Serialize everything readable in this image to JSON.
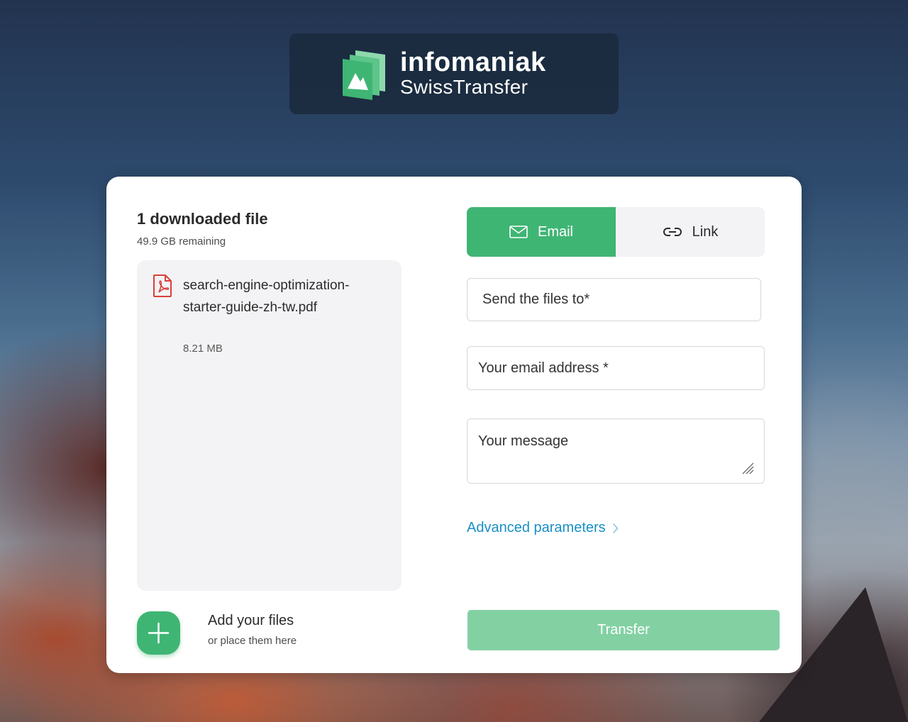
{
  "brand": {
    "name": "infomaniak",
    "product": "SwissTransfer"
  },
  "files": {
    "heading": "1 downloaded file",
    "remaining": "49.9 GB remaining",
    "items": [
      {
        "name": "search-engine-optimization-starter-guide-zh-tw.pdf",
        "size": "8.21 MB",
        "icon": "pdf-icon"
      }
    ],
    "add_title": "Add your files",
    "add_subtitle": "or place them here"
  },
  "tabs": {
    "email_label": "Email",
    "link_label": "Link",
    "active": "Email"
  },
  "form": {
    "to_placeholder": "Send the files to*",
    "from_placeholder": "Your email address *",
    "message_placeholder": "Your message",
    "advanced_label": "Advanced parameters",
    "transfer_label": "Transfer"
  },
  "colors": {
    "accent": "#3fb574",
    "accent_disabled": "#83d1a3",
    "link": "#1a8fc4",
    "pdf": "#d9403a"
  }
}
